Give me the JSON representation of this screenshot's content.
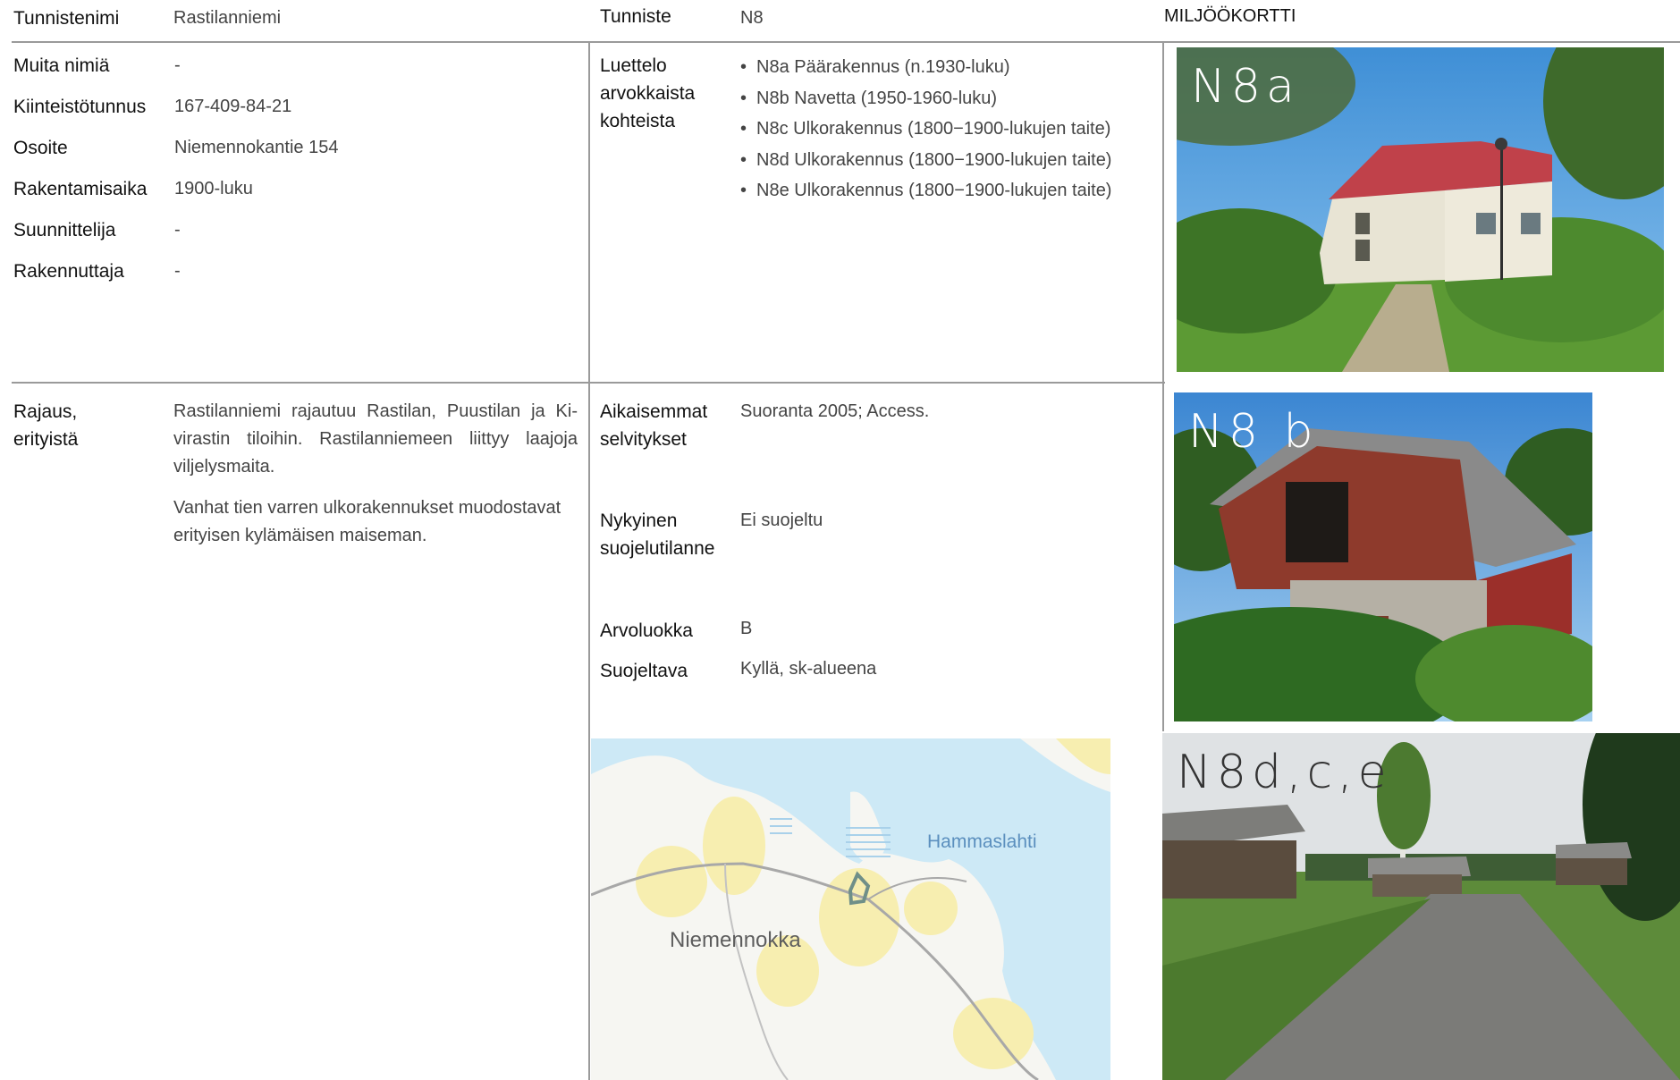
{
  "header": {
    "tunnistenimi_label": "Tunnistenimi",
    "tunnistenimi_value": "Rastilanniemi",
    "tunniste_label": "Tunniste",
    "tunniste_value": "N8",
    "card_title": "MILJÖÖKORTTI"
  },
  "info": [
    {
      "label": "Muita nimiä",
      "value": "-"
    },
    {
      "label": "Kiinteistötunnus",
      "value": "167-409-84-21"
    },
    {
      "label": "Osoite",
      "value": "Niemennokantie 154"
    },
    {
      "label": "Rakentamisaika",
      "value": "1900-luku"
    },
    {
      "label": "Suunnittelija",
      "value": "-"
    },
    {
      "label": "Rakennuttaja",
      "value": "-"
    }
  ],
  "luettelo": {
    "label_lines": [
      "Luettelo",
      "arvokkaista",
      "kohteista"
    ],
    "items": [
      "N8a Päärakennus (n.1930-luku)",
      "N8b Navetta  (1950-1960-luku)",
      "N8c Ulkorakennus (1800−1900-lukujen taite)",
      "N8d Ulkorakennus (1800−1900-lukujen taite)",
      "N8e Ulkorakennus (1800−1900-lukujen taite)"
    ]
  },
  "rajaus": {
    "label_lines": [
      "Rajaus,",
      "erityistä"
    ],
    "para1": "Rastilanniemi rajautuu Rastilan, Puustilan ja Ki­virastin tiloihin. Rastilanniemeen liittyy laajoja viljelysmaita.",
    "para2": "Vanhat tien varren ulkorakennukset muodostavat erityisen kylämäisen maiseman."
  },
  "details": {
    "aikaisemmat_lines": [
      "Aikaisemmat",
      "selvitykset"
    ],
    "aikaisemmat_value": "Suoranta 2005; Access.",
    "nykyinen_lines": [
      "Nykyinen",
      "suojelutilanne"
    ],
    "nykyinen_value": "Ei suojeltu",
    "arvoluokka_label": "Arvoluokka",
    "arvoluokka_value": "B",
    "suojeltava_label": "Suojeltava",
    "suojeltava_value": "Kyllä, sk-alueena"
  },
  "photos": {
    "p1_label": "N8a",
    "p2_label": "N8 b",
    "p3_label": "N8d,c,e"
  },
  "map": {
    "place1": "Niemennokka",
    "place2": "Hammaslahti"
  }
}
